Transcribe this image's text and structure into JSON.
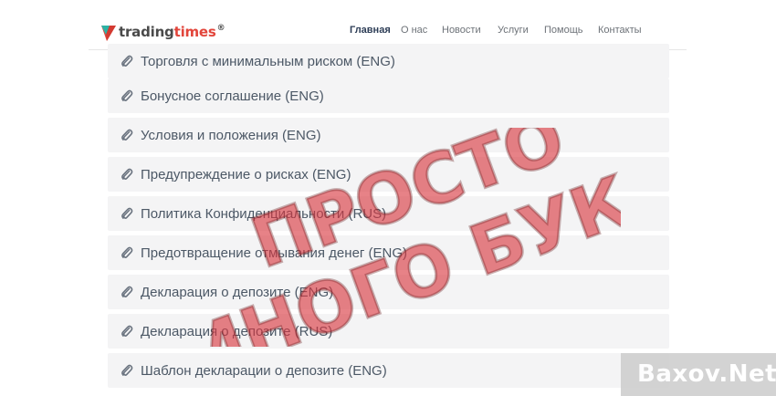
{
  "brand": {
    "name_part1": "trading",
    "name_part2": "times",
    "mark": "®",
    "accent": "#e2453b",
    "teal": "#2bb3a5"
  },
  "nav": {
    "items": [
      "Главная",
      "О нас",
      "Новости",
      "Услуги",
      "Помощь",
      "Контакты"
    ],
    "active": "Главная"
  },
  "documents": [
    "Торговля с минимальным риском (ENG)",
    "Бонусное соглашение (ENG)",
    "Условия и положения (ENG)",
    "Предупреждение о рисках (ENG)",
    "Политика Конфиденциальности (RUS)",
    "Предотвращение отмывания денег (ENG)",
    "Декларация о депозите (ENG)",
    "Декларация о депозите (RUS)",
    "Шаблон декларации о депозите (ENG)"
  ],
  "stamp": {
    "line1": "ПРОСТО",
    "line2": "МНОГО БУКВ",
    "color": "#d9363e"
  },
  "watermark": {
    "text": "Baxov.Net"
  },
  "icons": {
    "document": "paperclip-icon",
    "logo": "logo-triangle-icon"
  }
}
